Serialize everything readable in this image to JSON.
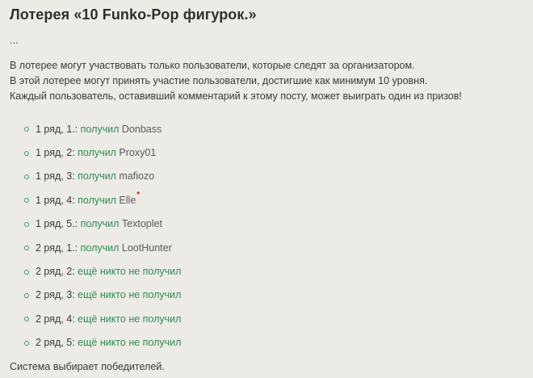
{
  "title": "Лотерея «10 Funko-Pop фигурок.»",
  "ellipsis": "...",
  "intro": [
    "В лотерее могут участвовать только пользователи, которые следят за организатором.",
    "В этой лотерее могут принять участие пользователи, достигшие как минимум 10 уровня.",
    "Каждый пользователь, оставивший комментарий к этому посту, может выиграть один из призов!"
  ],
  "prizes": [
    {
      "label": "1 ряд, 1.:",
      "status": "получил",
      "winner": "Donbass"
    },
    {
      "label": "1 ряд, 2:",
      "status": "получил",
      "winner": "Proxy01"
    },
    {
      "label": "1 ряд, 3:",
      "status": "получил",
      "winner": "mafiozo"
    },
    {
      "label": "1 ряд, 4:",
      "status": "получил",
      "winner": "Elle",
      "mark": "*"
    },
    {
      "label": "1 ряд, 5.:",
      "status": "получил",
      "winner": "Textoplet"
    },
    {
      "label": "2 ряд, 1.:",
      "status": "получил",
      "winner": "LootHunter"
    },
    {
      "label": "2 ряд, 2:",
      "status": "ещё никто не получил"
    },
    {
      "label": "2 ряд, 3:",
      "status": "ещё никто не получил"
    },
    {
      "label": "2 ряд, 4:",
      "status": "ещё никто не получил"
    },
    {
      "label": "2 ряд, 5:",
      "status": "ещё никто не получил"
    }
  ],
  "footer": "Система выбирает победителей.",
  "colors": {
    "background": "#edebe6",
    "status_green": "#2f8a56",
    "mark_red": "#c0281e"
  }
}
